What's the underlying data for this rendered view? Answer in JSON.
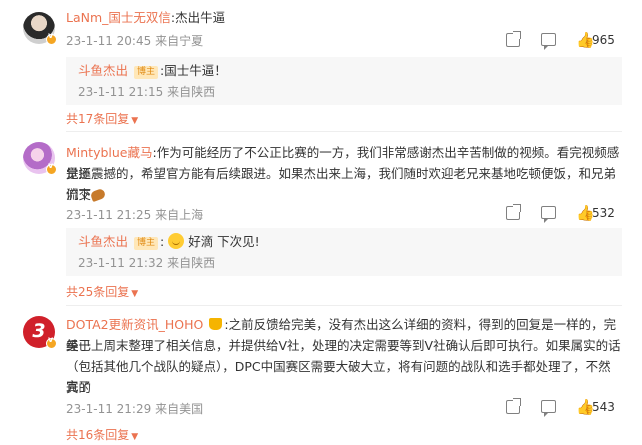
{
  "comments": [
    {
      "username": "LaNm_国士无双信",
      "separator": ":",
      "text": "杰出牛逼",
      "time": "23-1-11 20:45",
      "location": "来自宁夏",
      "likes": "965",
      "reply": {
        "username": "斗鱼杰出",
        "badge": "博主",
        "separator": ":",
        "text": "国士牛逼！",
        "time": "23-1-11 21:15",
        "location": "来自陕西"
      },
      "more_replies": "共17条回复"
    },
    {
      "username": "Mintyblue藏马",
      "separator": ":",
      "text_line1": "作为可能经历了不公正比赛的一方，我们非常感谢杰出辛苦制做的视频。看完视频感觉还",
      "text_line2": "是挺震撼的，希望官方能有后续跟进。如果杰出来上海，我们随时欢迎老兄来基地吃顿便饭，和兄弟们交",
      "text_line3": "流下",
      "time": "23-1-11 21:25",
      "location": "来自上海",
      "likes": "532",
      "reply": {
        "username": "斗鱼杰出",
        "badge": "博主",
        "separator": ":",
        "text": "好滴 下次见!",
        "time": "23-1-11 21:32",
        "location": "来自陕西"
      },
      "more_replies": "共25条回复"
    },
    {
      "username": "DOTA2更新资讯_HOHO",
      "separator": ":",
      "text_line1": "之前反馈给完美，没有杰出这么详细的资料，得到的回复是一样的，完美已",
      "text_line2": "经于上周末整理了相关信息，并提供给V社，处理的决定需要等到V社确认后即可执行。如果属实的话",
      "text_line3": "（包括其他几个战队的疑点），DPC中国赛区需要大破大立，将有问题的战队和选手都处理了，不然真的",
      "text_line4": "完了",
      "time": "23-1-11 21:29",
      "location": "来自美国",
      "likes": "543",
      "more_replies": "共16条回复"
    }
  ],
  "icons": {
    "share": "share-icon",
    "comment": "comment-icon",
    "like": "thumbs-up-icon",
    "verified": "verified-badge-icon",
    "more": "chevron-down-icon"
  },
  "colors": {
    "username": "#eb7350",
    "meta": "#939393",
    "reply_bg": "#f7f7f7",
    "badge_bg": "#ffe7b8",
    "badge_text": "#e08a12"
  }
}
